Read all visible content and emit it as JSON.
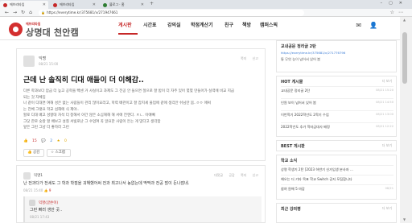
{
  "browser": {
    "tabs": [
      {
        "label": "에브리타임"
      },
      {
        "label": "에브리타임"
      },
      {
        "label": "블로그 · 홈"
      }
    ],
    "url": "https://everytime.kr/375681/v/271947661"
  },
  "header": {
    "logo_sub": "에브리타임",
    "logo_title": "상명대 천안캠",
    "nav": [
      "게시판",
      "시간표",
      "강의실",
      "학점계산기",
      "친구",
      "책방",
      "캠퍼스픽"
    ]
  },
  "post": {
    "author": "익명",
    "date": "08/21 15:00",
    "actions": [
      "쪽지",
      "신고"
    ],
    "title": "근데 난 솔직히 디대 애들이 더 이해감..",
    "body": [
      "다른 학과보다 압금 더 높고 공학을 빡센 거 사실이고 과제도 그 전공 안 들으면 절으로 잘 밤이 더 자주 있어 몇몇 만들어가 실력에 비교 지금",
      "되는 것 자체임",
      "나 같이 디대면 여해 성은 없는 사람들이 관리 많이요라고, 학력 배관이고 잘 잡치세 물업에 같에 생각안 쉬님만 몸..ㅇㅇ 애써",
      "는 전체 그렇요 학교 섭해에 식 제야..",
      "할로 디대 배고 성향대 차석 더 창해서 야간 않은 소심해해 해 서애 전엔다. ㅈㄴ. 이애빼",
      "그닷 한로 숫칼 할 배보고 설칠 서빚로난 그 수업여 꼭 알요한 사람이 든는 게 맞다고 생각함",
      "앞은 그런 그냥 더 좋자라 그런"
    ],
    "likes": "15",
    "comments": "2",
    "scraps": "0",
    "like_button": "공감",
    "scrap_button": "스크랩"
  },
  "comment": {
    "author": "익명1",
    "actions": [
      "대댓글",
      "공감",
      "쪽지",
      "신고"
    ],
    "text": "난 전과다가 전세도 그 학과 학점을 괴해했어써 전과 최고나서 농없는데 딱딱과 전공 많이 든나잖네.",
    "date": "08/21 15:40",
    "likes": "9",
    "reply": {
      "author": "익명(글쓴이)",
      "text": "그런 빠러 생안 곳..",
      "date": "08/21 17:43"
    }
  },
  "sidebar": {
    "notice": {
      "title": "교내공문 정리글 2탄",
      "link": "https://everytime.kr/375681/v/271776796",
      "text": "통 무엇 능이 넘어서 있어 봄"
    },
    "hot": {
      "title": "HOT 게시물",
      "more": "더 보기",
      "items": [
        {
          "t": "교내공문 정리글 2탄",
          "d": "08/21 15:20"
        },
        {
          "t": "인원 보이 넘어서 있어 봄",
          "d": "08/21 14:50"
        },
        {
          "t": "이번학기 2022학년도 2학기 수업",
          "d": "08/21 13:00"
        },
        {
          "t": "2022학년도 추가 학자금대사 배정",
          "d": "08/21 12:22"
        }
      ]
    },
    "best": {
      "title": "BEST 게시판",
      "more": "더 보기"
    },
    "school": {
      "title": "학교 소식",
      "items": [
        {
          "t": "상명 학생기 2탄 [2023 하반기 신가입생 분사자 ...",
          "d": ""
        },
        {
          "t": "해오는 더 기타 목표 학교 Switch 공지 모집합니다",
          "d": ""
        },
        {
          "t": "참여 원해 5 마감",
          "d": "08/21"
        }
      ]
    },
    "recent": {
      "title": "최근 강의평",
      "more": "더 보기"
    }
  }
}
